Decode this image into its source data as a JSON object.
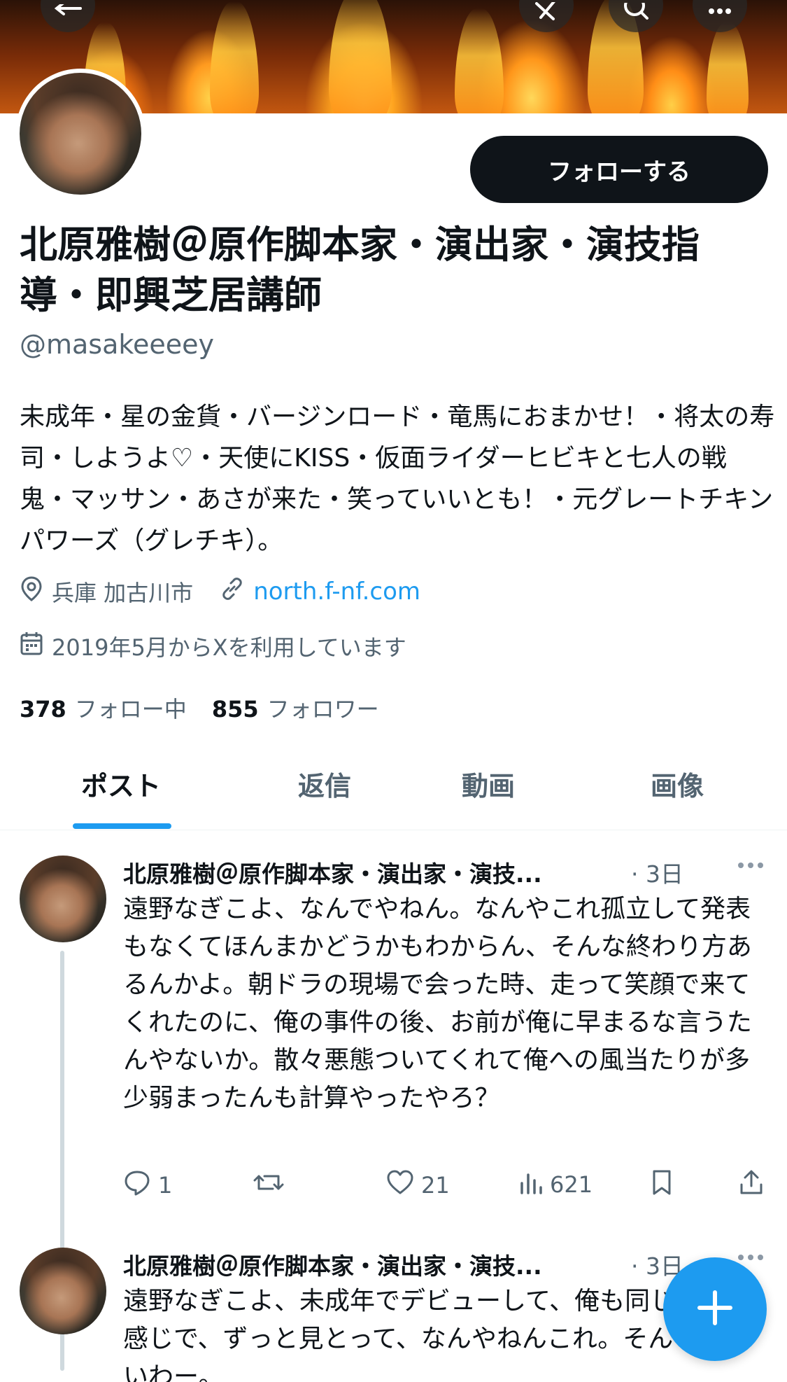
{
  "header": {
    "follow_label": "フォローする"
  },
  "profile": {
    "display_name": "北原雅樹＠原作脚本家・演出家・演技指導・即興芝居講師",
    "handle": "@masakeeeey",
    "bio": "未成年・星の金貨・バージンロード・竜馬におまかせ！・将太の寿司・しようよ♡・天使にKISS・仮面ライダーヒビキと七人の戦鬼・マッサン・あさが来た・笑っていいとも！・元グレートチキンパワーズ（グレチキ）。",
    "location": "兵庫 加古川市",
    "website": "north.f-nf.com",
    "joined": "2019年5月からXを利用しています",
    "following_count": "378",
    "following_label": "フォロー中",
    "followers_count": "855",
    "followers_label": "フォロワー"
  },
  "tabs": [
    {
      "label": "ポスト",
      "active": true
    },
    {
      "label": "返信",
      "active": false
    },
    {
      "label": "動画",
      "active": false
    },
    {
      "label": "画像",
      "active": false
    }
  ],
  "posts": [
    {
      "author": "北原雅樹＠原作脚本家・演出家・演技...",
      "time": "· 3日",
      "text": "遠野なぎこよ、なんでやねん。なんやこれ孤立して発表もなくてほんまかどうかもわからん、そんな終わり方あるんかよ。朝ドラの現場で会った時、走って笑顔で来てくれたのに、俺の事件の後、お前が俺に早まるな言うたんやないか。散々悪態ついてくれて俺への風当たりが多少弱まったんも計算やったやろ？",
      "replies": "1",
      "reposts": "",
      "likes": "21",
      "views": "621"
    },
    {
      "author": "北原雅樹＠原作脚本家・演出家・演技...",
      "time": "· 3日",
      "text": "遠野なぎこよ、未成年でデビューして、俺も同じような感じで、ずっと見とって、なんやねんこれ。そんなんないわー。"
    }
  ],
  "colors": {
    "accent": "#1d9bf0",
    "text": "#0f1419",
    "secondary": "#536471"
  },
  "icons": [
    "back-arrow-icon",
    "grok-icon",
    "search-icon",
    "more-icon",
    "location-icon",
    "link-icon",
    "calendar-icon",
    "reply-icon",
    "repost-icon",
    "like-icon",
    "views-icon",
    "bookmark-icon",
    "share-icon",
    "compose-plus-icon"
  ]
}
